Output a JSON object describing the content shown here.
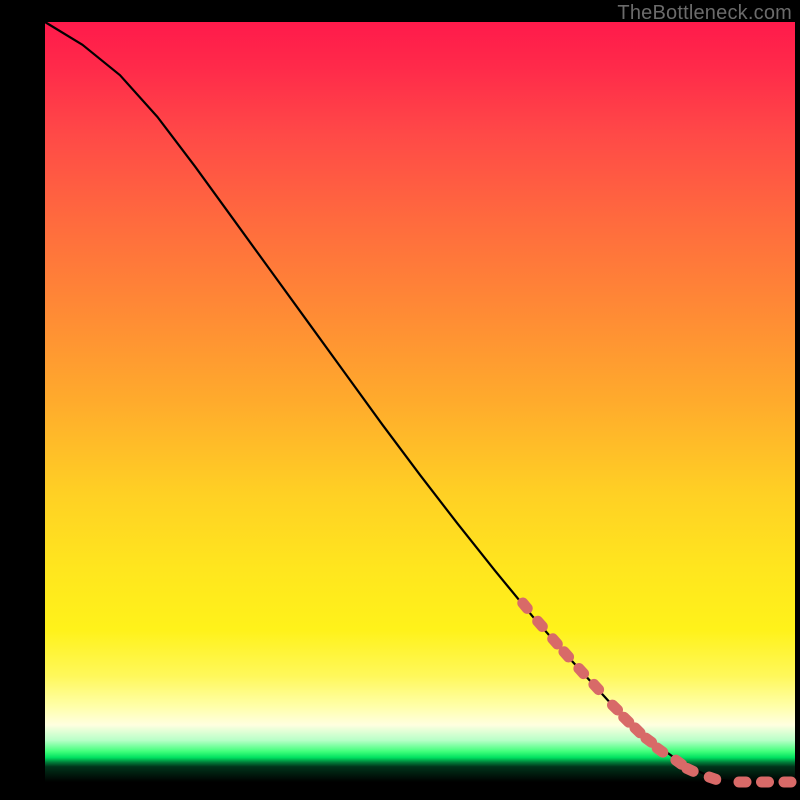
{
  "attribution": "TheBottleneck.com",
  "colors": {
    "line": "#000000",
    "marker": "#d86a68",
    "background_top": "#ff1a4b",
    "background_mid": "#ffe61e",
    "background_low": "#00e060",
    "frame": "#000000"
  },
  "chart_data": {
    "type": "line",
    "title": "",
    "xlabel": "",
    "ylabel": "",
    "xlim": [
      0,
      100
    ],
    "ylim": [
      0,
      100
    ],
    "grid": false,
    "series": [
      {
        "name": "curve",
        "x": [
          0,
          5,
          10,
          15,
          20,
          25,
          30,
          35,
          40,
          45,
          50,
          55,
          60,
          65,
          70,
          75,
          80,
          85,
          88,
          90,
          92,
          95,
          100
        ],
        "y": [
          100,
          97,
          93,
          87.5,
          81,
          74.2,
          67.4,
          60.6,
          53.8,
          47,
          40.4,
          34,
          27.8,
          21.8,
          16.2,
          10.8,
          6,
          2.4,
          1,
          0.3,
          0,
          0,
          0
        ]
      }
    ],
    "markers": {
      "name": "highlighted-points",
      "style": "obround",
      "color": "#d86a68",
      "points": [
        {
          "x": 64.0,
          "y": 23.2
        },
        {
          "x": 66.0,
          "y": 20.8
        },
        {
          "x": 68.0,
          "y": 18.5
        },
        {
          "x": 69.5,
          "y": 16.8
        },
        {
          "x": 71.5,
          "y": 14.6
        },
        {
          "x": 73.5,
          "y": 12.5
        },
        {
          "x": 76.0,
          "y": 9.8
        },
        {
          "x": 77.5,
          "y": 8.2
        },
        {
          "x": 79.0,
          "y": 6.8
        },
        {
          "x": 80.5,
          "y": 5.5
        },
        {
          "x": 82.0,
          "y": 4.2
        },
        {
          "x": 84.5,
          "y": 2.6
        },
        {
          "x": 86.0,
          "y": 1.6
        },
        {
          "x": 89.0,
          "y": 0.5
        },
        {
          "x": 93.0,
          "y": 0.0
        },
        {
          "x": 96.0,
          "y": 0.0
        },
        {
          "x": 99.0,
          "y": 0.0
        }
      ]
    }
  }
}
